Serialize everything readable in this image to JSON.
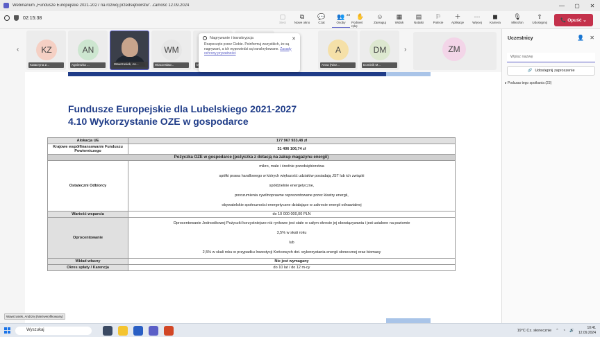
{
  "window": {
    "title": "Webinarium „Fundusze Europejskie 2021-2027 na rozwój przedsiębiorstw”. Zamość 12.09.2024"
  },
  "meeting": {
    "timer": "02:15:38",
    "toolbar": [
      {
        "label": "Sieci",
        "icon": "▢",
        "dim": true
      },
      {
        "label": "Nowe okno",
        "icon": "⧉",
        "dim": false
      },
      {
        "label": "Czat",
        "icon": "💬",
        "dim": false
      },
      {
        "label": "Osoby",
        "icon": "👥",
        "badge": "23",
        "active": true
      },
      {
        "label": "Podnieś rękę",
        "icon": "✋",
        "dim": false
      },
      {
        "label": "Zareaguj",
        "icon": "☺",
        "dim": false
      },
      {
        "label": "Widok",
        "icon": "▦",
        "dim": false
      },
      {
        "label": "Notatki",
        "icon": "▤",
        "dim": false
      },
      {
        "label": "Polecie",
        "icon": "⚐",
        "dim": false
      },
      {
        "label": "Aplikacje",
        "icon": "＋",
        "dim": false
      },
      {
        "label": "Więcej",
        "icon": "⋯",
        "dim": false
      }
    ],
    "devices": [
      {
        "label": "Kamera",
        "icon": "◼"
      },
      {
        "label": "Mikrofon",
        "icon": "🎙"
      },
      {
        "label": "Udostępnij",
        "icon": "⇪"
      }
    ],
    "leave_label": "Opuść"
  },
  "gallery": {
    "tiles": [
      {
        "initials": "KZ",
        "name": "Katarzyna Z...",
        "color": "#f5d0c4"
      },
      {
        "initials": "AN",
        "name": "Agnieszka ...",
        "color": "#cde6d0"
      },
      {
        "initials": "",
        "name": "Wawrzusiek, An...",
        "video": true
      },
      {
        "initials": "WM",
        "name": "Wiaczesław...",
        "color": "#e6e6e6"
      },
      {
        "initials": "",
        "name": "M",
        "color": "#e6e6e6"
      },
      {
        "initials": "",
        "name": "",
        "color": "#f3d0d8"
      },
      {
        "initials": "A",
        "name": "Anna (Niez...",
        "color": "#f5e0a8"
      },
      {
        "initials": "DM",
        "name": "Dominik M...",
        "color": "#dde8d0"
      }
    ],
    "big_tile": {
      "initials": "ZM"
    }
  },
  "popup": {
    "title": "Nagrywanie i transkrypcja",
    "body": "Rozpoczęto przez Ciebie. Poinformuj wszystkich, że są nagrywani, a ich wypowiedzi są transkrybowane.",
    "link": "Zasady ochrony prywatności"
  },
  "slide": {
    "title_line1": "Fundusze Europejskie dla Lubelskiego 2021-2027",
    "title_line2": "4.10 Wykorzystanie OZE w gospodarce",
    "rows": {
      "alokacja_label": "Alokacja UE",
      "alokacja_value": "177 967 933,48 zł",
      "krajowe_label": "Krajowe współfinansowanie Funduszu Powierniczego",
      "krajowe_value": "31 406 106,74 zł",
      "pozyczka_header": "Pożyczka OZE w gospodarce (pożyczka z dotacją na zakup magazynu energii)",
      "odbiorcy_label": "Ostateczni Odbiorcy",
      "odbiorcy_lines": [
        "mikro, małe i średnie przedsiębiorstwa",
        "spółki prawa handlowego w których większość udziałów posiadają JST lub ich związki",
        "spółdzielnie energetyczne,",
        "porozumienia cywilnoprawne reprezentowane przez klastry energii,",
        "obywatelskie społeczności energetyczne działające w zakresie energii odnawialnej"
      ],
      "wartosc_label": "Wartość wsparcia",
      "wartosc_value": "do 10 000 000,00 PLN",
      "oprocentowanie_label": "Oprocentowanie",
      "oprocentowanie_lines": [
        "Oprocentowanie Jednostkowej Pożyczki korzystniejsze niż rynkowe jest stałe w całym okresie jej obowiązywania i jest ustalone na poziomie",
        "3,5% w skali roku",
        "lub",
        "2,5% w skali roku w przypadku Inwestycji Końcowych dot. wykorzystania energii słonecznej oraz biomasy"
      ],
      "wklad_label": "Wkład własny",
      "wklad_value": "Nie jest wymagany",
      "okres_label": "Okres spłaty / Karencja",
      "okres_value": "do 10 lat / do 12 m-cy"
    }
  },
  "presenter_label": "Wawrzusiek, Andrzej (Niezweryfikowany)",
  "sidebar": {
    "title": "Uczestnicy",
    "search_placeholder": "Wpisz nazwę",
    "share_label": "Udostępnij zaproszenie",
    "during_label": "Podczas tego spotkania (23)"
  },
  "taskbar": {
    "search_label": "Wyszukaj",
    "weather": "19°C  Cz. słonecznie",
    "time": "10:41",
    "date": "12.09.2024"
  }
}
